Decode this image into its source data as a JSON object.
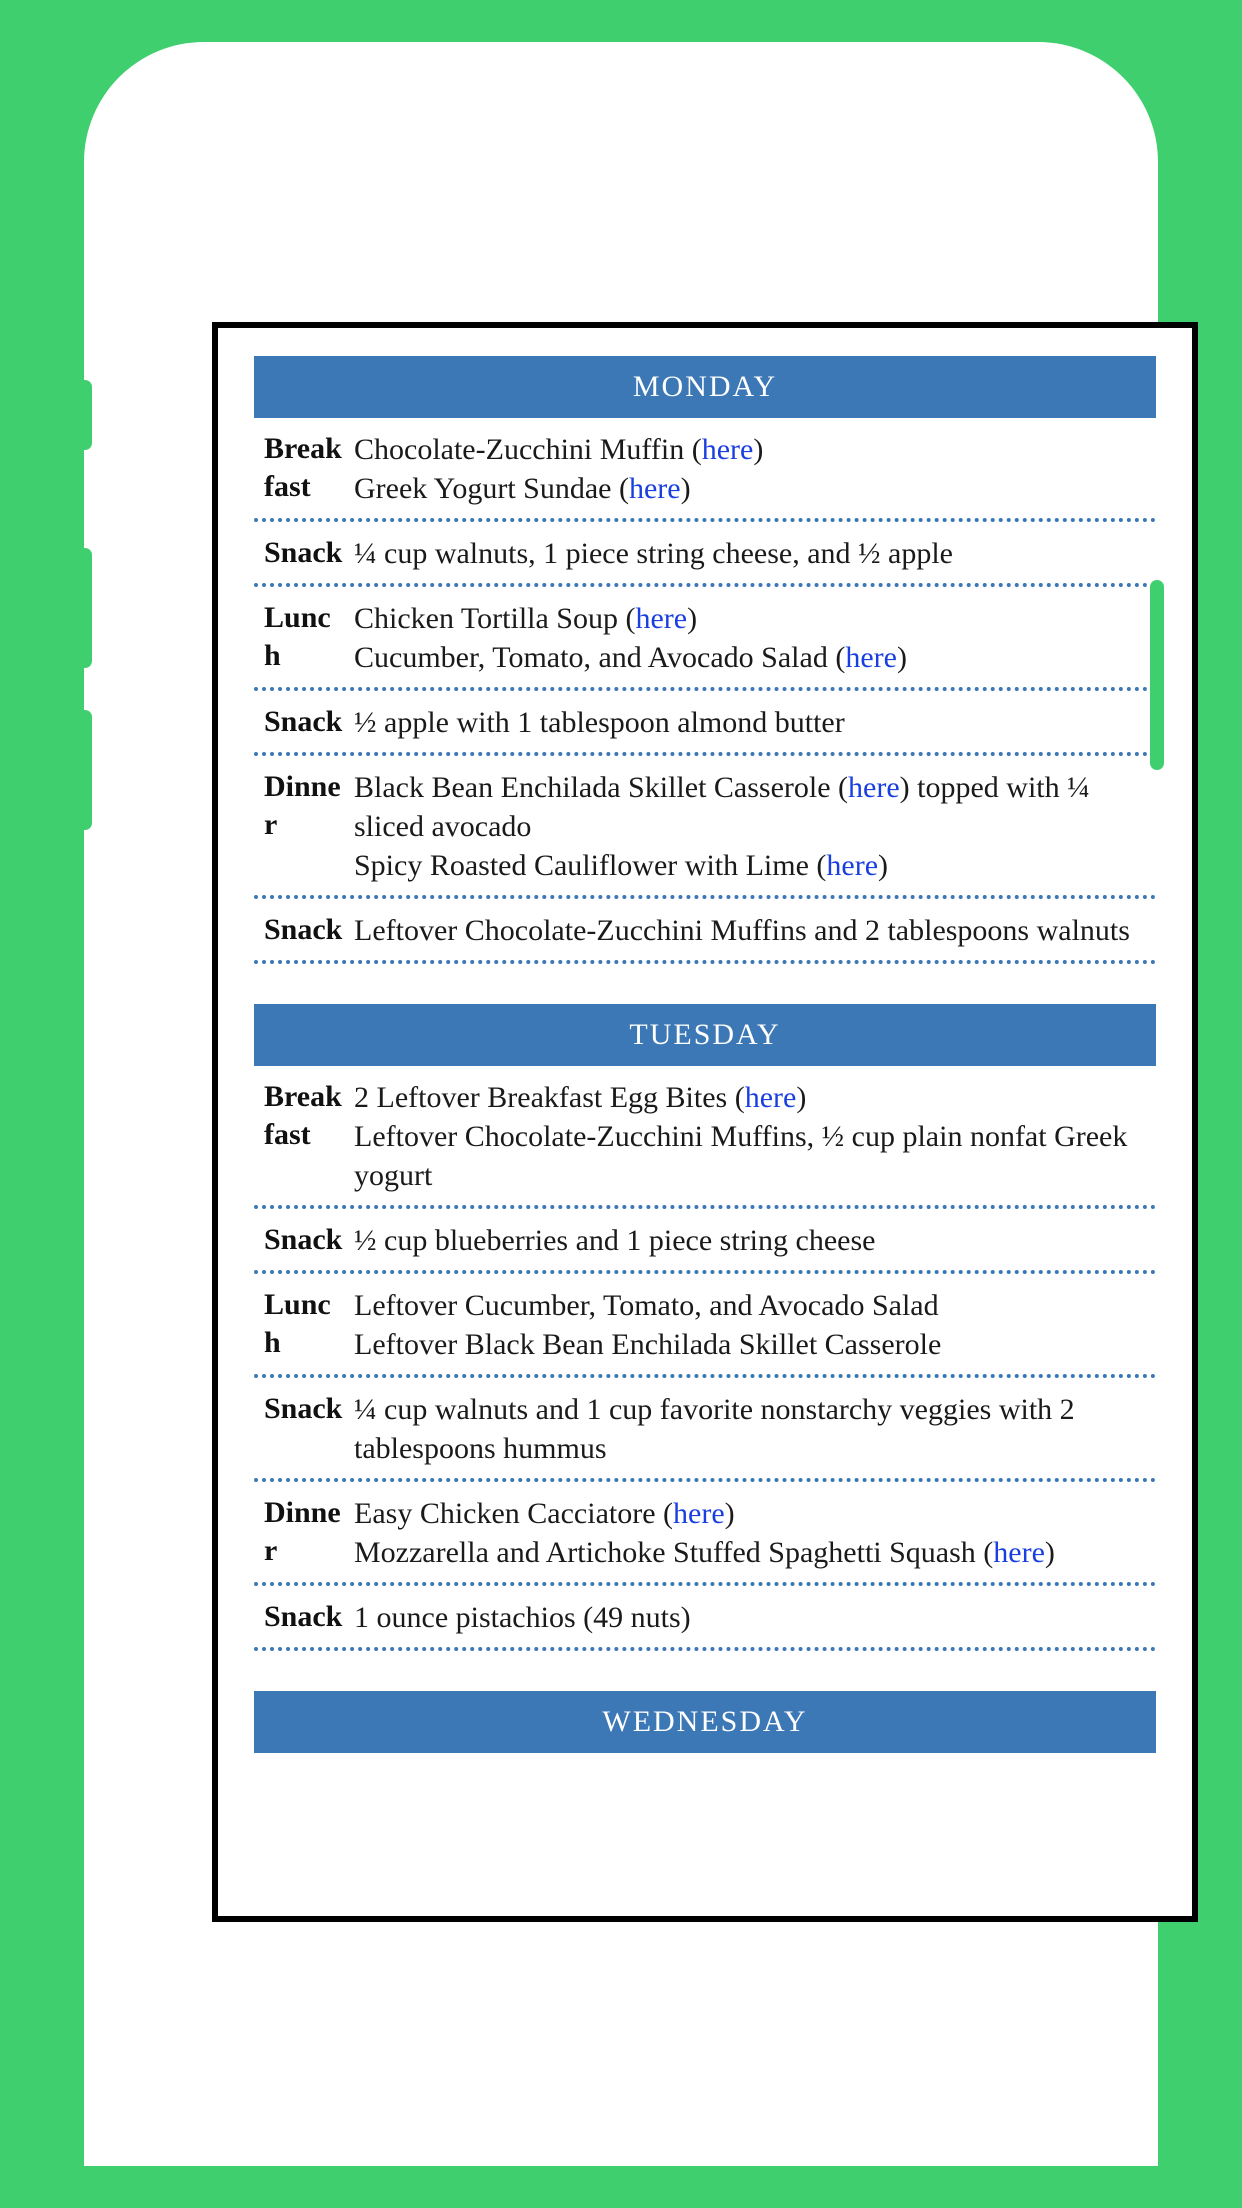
{
  "days": [
    {
      "name": "MONDAY",
      "meals": [
        {
          "label": "Breakfast",
          "lines": [
            {
              "parts": [
                {
                  "t": "Chocolate-Zucchini Muffin ("
                },
                {
                  "t": "here",
                  "link": true
                },
                {
                  "t": ")"
                }
              ]
            },
            {
              "parts": [
                {
                  "t": "Greek Yogurt Sundae ("
                },
                {
                  "t": "here",
                  "link": true
                },
                {
                  "t": ")"
                }
              ]
            }
          ]
        },
        {
          "label": "Snack",
          "lines": [
            {
              "parts": [
                {
                  "t": "¼ cup walnuts, 1 piece string cheese, and ½ apple"
                }
              ]
            }
          ]
        },
        {
          "label": "Lunch",
          "lines": [
            {
              "parts": [
                {
                  "t": "Chicken Tortilla Soup ("
                },
                {
                  "t": "here",
                  "link": true
                },
                {
                  "t": ")"
                }
              ]
            },
            {
              "parts": [
                {
                  "t": "Cucumber, Tomato, and Avocado Salad ("
                },
                {
                  "t": "here",
                  "link": true
                },
                {
                  "t": ")"
                }
              ]
            }
          ]
        },
        {
          "label": "Snack",
          "lines": [
            {
              "parts": [
                {
                  "t": "½ apple with 1 tablespoon almond butter"
                }
              ]
            }
          ]
        },
        {
          "label": "Dinner",
          "lines": [
            {
              "parts": [
                {
                  "t": "Black Bean Enchilada Skillet Casserole ("
                },
                {
                  "t": "here",
                  "link": true
                },
                {
                  "t": ") topped with ¼ sliced avocado"
                }
              ]
            },
            {
              "parts": [
                {
                  "t": "Spicy Roasted Cauliflower with Lime ("
                },
                {
                  "t": "here",
                  "link": true
                },
                {
                  "t": ")"
                }
              ]
            }
          ]
        },
        {
          "label": "Snack",
          "lines": [
            {
              "parts": [
                {
                  "t": "Leftover Chocolate-Zucchini Muffins and 2 tablespoons walnuts"
                }
              ]
            }
          ]
        }
      ]
    },
    {
      "name": "TUESDAY",
      "meals": [
        {
          "label": "Breakfast",
          "lines": [
            {
              "parts": [
                {
                  "t": "2 Leftover Breakfast Egg Bites ("
                },
                {
                  "t": "here",
                  "link": true
                },
                {
                  "t": ")"
                }
              ]
            },
            {
              "parts": [
                {
                  "t": "Leftover Chocolate-Zucchini Muffins, ½ cup plain nonfat Greek yogurt"
                }
              ]
            }
          ]
        },
        {
          "label": "Snack",
          "lines": [
            {
              "parts": [
                {
                  "t": "½ cup blueberries and 1 piece string cheese"
                }
              ]
            }
          ]
        },
        {
          "label": "Lunch",
          "lines": [
            {
              "parts": [
                {
                  "t": "Leftover Cucumber, Tomato, and Avocado Salad"
                }
              ]
            },
            {
              "parts": [
                {
                  "t": "Leftover Black Bean Enchilada Skillet Casserole"
                }
              ]
            }
          ]
        },
        {
          "label": "Snack",
          "lines": [
            {
              "parts": [
                {
                  "t": "¼ cup walnuts and 1 cup favorite nonstarchy veggies with 2 tablespoons hummus"
                }
              ]
            }
          ]
        },
        {
          "label": "Dinner",
          "lines": [
            {
              "parts": [
                {
                  "t": "Easy Chicken Cacciatore ("
                },
                {
                  "t": "here",
                  "link": true
                },
                {
                  "t": ")"
                }
              ]
            },
            {
              "parts": [
                {
                  "t": "Mozzarella and Artichoke Stuffed Spaghetti Squash ("
                },
                {
                  "t": "here",
                  "link": true
                },
                {
                  "t": ")"
                }
              ]
            }
          ]
        },
        {
          "label": "Snack",
          "lines": [
            {
              "parts": [
                {
                  "t": "1 ounce pistachios (49 nuts)"
                }
              ]
            }
          ]
        }
      ]
    },
    {
      "name": "WEDNESDAY",
      "meals": []
    }
  ]
}
